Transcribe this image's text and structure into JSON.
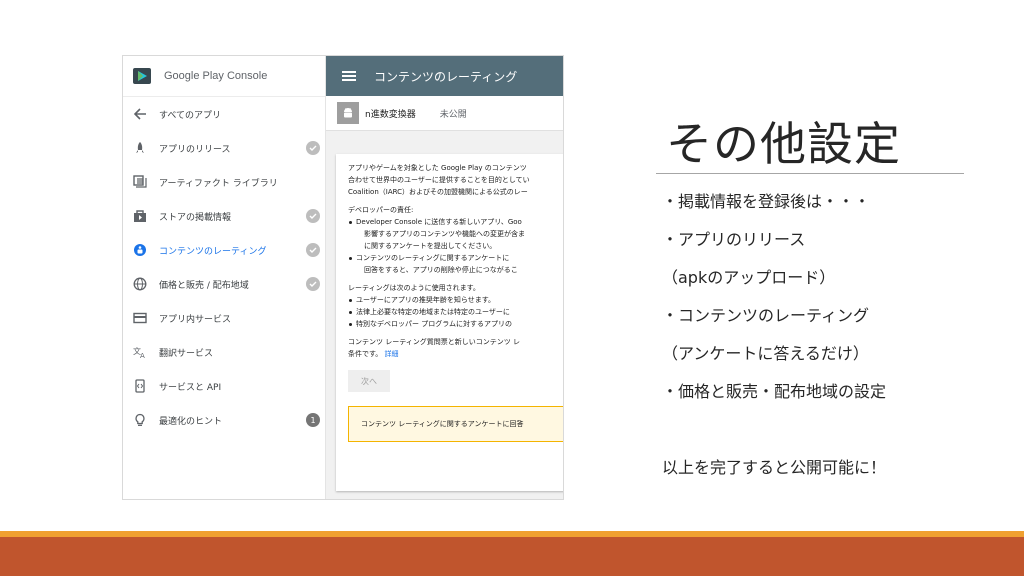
{
  "console": {
    "logo_text": "Google Play Console",
    "nav": [
      {
        "label": "すべてのアプリ",
        "icon": "back-arrow-icon",
        "status": ""
      },
      {
        "label": "アプリのリリース",
        "icon": "rocket-icon",
        "status": "check"
      },
      {
        "label": "アーティファクト ライブラリ",
        "icon": "library-icon",
        "status": ""
      },
      {
        "label": "ストアの掲載情報",
        "icon": "store-icon",
        "status": "check"
      },
      {
        "label": "コンテンツのレーティング",
        "icon": "content-rating-icon",
        "status": "check"
      },
      {
        "label": "価格と販売 / 配布地域",
        "icon": "globe-icon",
        "status": "check"
      },
      {
        "label": "アプリ内サービス",
        "icon": "card-icon",
        "status": ""
      },
      {
        "label": "翻訳サービス",
        "icon": "translate-icon",
        "status": ""
      },
      {
        "label": "サービスと API",
        "icon": "api-icon",
        "status": ""
      },
      {
        "label": "最適化のヒント",
        "icon": "lightbulb-icon",
        "status": "1"
      }
    ],
    "topbar_title": "コンテンツのレーティング",
    "app_name": "n進数変換器",
    "app_status": "未公開",
    "card": {
      "intro": [
        "アプリやゲームを対象とした Google Play のコンテンツ",
        "合わせて世界中のユーザーに提供することを目的としてい",
        "Coalition（IARC）およびその加盟機関による公式のレー"
      ],
      "dev_heading": "デベロッパーの責任:",
      "dev_bullets": [
        [
          "Developer Console に送信する新しいアプリ、Goo",
          "影響するアプリのコンテンツや機能への変更が含ま",
          "に関するアンケートを提出してください。"
        ],
        [
          "コンテンツのレーティングに関するアンケートに",
          "回答をすると、アプリの削除や停止につながるこ"
        ]
      ],
      "use_heading": "レーティングは次のように使用されます。",
      "use_bullets": [
        "ユーザーにアプリの推奨年齢を知らせます。",
        "法律上必要な特定の地域または特定のユーザーに",
        "特別なデベロッパー プログラムに対するアプリの"
      ],
      "footer_text": [
        "コンテンツ レーティング質問票と新しいコンテンツ レ",
        "条件です。"
      ],
      "link": "詳細",
      "next_button": "次へ",
      "notice": "コンテンツ レーティングに関するアンケートに回答"
    }
  },
  "slide": {
    "title": "その他設定",
    "lines": [
      "・掲載情報を登録後は・・・",
      "・アプリのリリース",
      "（apkのアップロード）",
      "・コンテンツのレーティング",
      "（アンケートに答えるだけ）",
      "・価格と販売・配布地域の設定",
      "以上を完了すると公開可能に！"
    ]
  },
  "colors": {
    "topbar": "#546e7a",
    "active_nav": "#1a73e8",
    "stripe_orange": "#f0a030",
    "stripe_rust": "#c0552d"
  }
}
